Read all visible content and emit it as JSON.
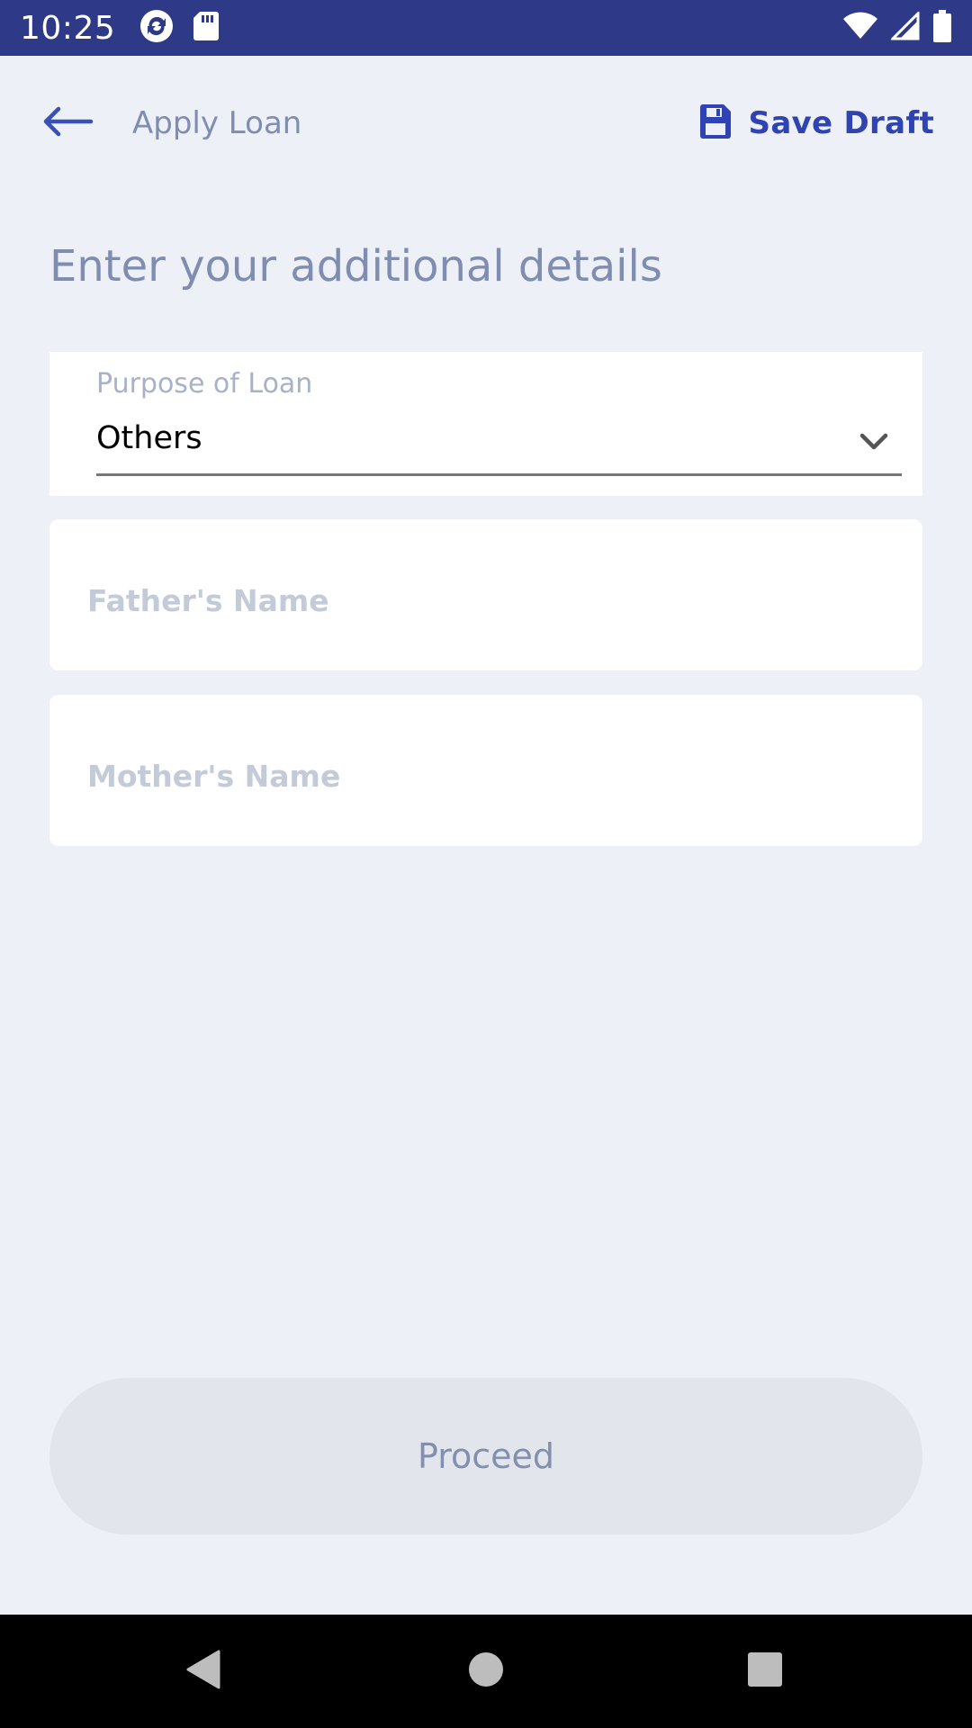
{
  "status_bar": {
    "time": "10:25",
    "icons": [
      "sync-icon",
      "sd-card-icon",
      "wifi-icon",
      "signal-icon",
      "battery-icon"
    ]
  },
  "header": {
    "title": "Apply Loan",
    "save_draft_label": "Save Draft",
    "accent_color": "#2f43b3"
  },
  "form": {
    "section_title": "Enter your additional details",
    "purpose": {
      "label": "Purpose of Loan",
      "value": "Others"
    },
    "father_name": {
      "placeholder": "Father's Name",
      "value": ""
    },
    "mother_name": {
      "placeholder": "Mother's Name",
      "value": ""
    }
  },
  "actions": {
    "proceed_label": "Proceed"
  },
  "colors": {
    "status_bar": "#2e3a87",
    "background": "#edf0f7",
    "muted_text": "#7f8db0"
  }
}
